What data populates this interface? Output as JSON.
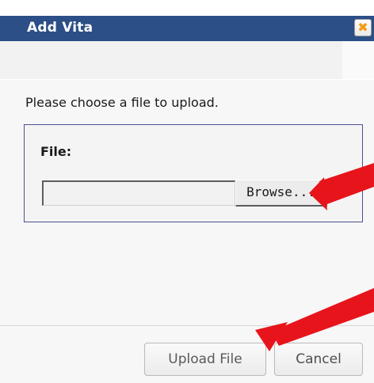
{
  "dialog": {
    "title": "Add Vita",
    "close_icon": "close-icon",
    "close_glyph": "✖"
  },
  "main": {
    "instruction": "Please choose a file to upload.",
    "file_label": "File:",
    "file_value": "",
    "browse_label": "Browse..."
  },
  "footer": {
    "upload_label": "Upload File",
    "cancel_label": "Cancel"
  },
  "annotations": {
    "arrow_color": "#e8141b"
  },
  "colors": {
    "titlebar": "#2b4f86",
    "accent_close": "#f39c12",
    "group_border": "#4c4f93"
  }
}
